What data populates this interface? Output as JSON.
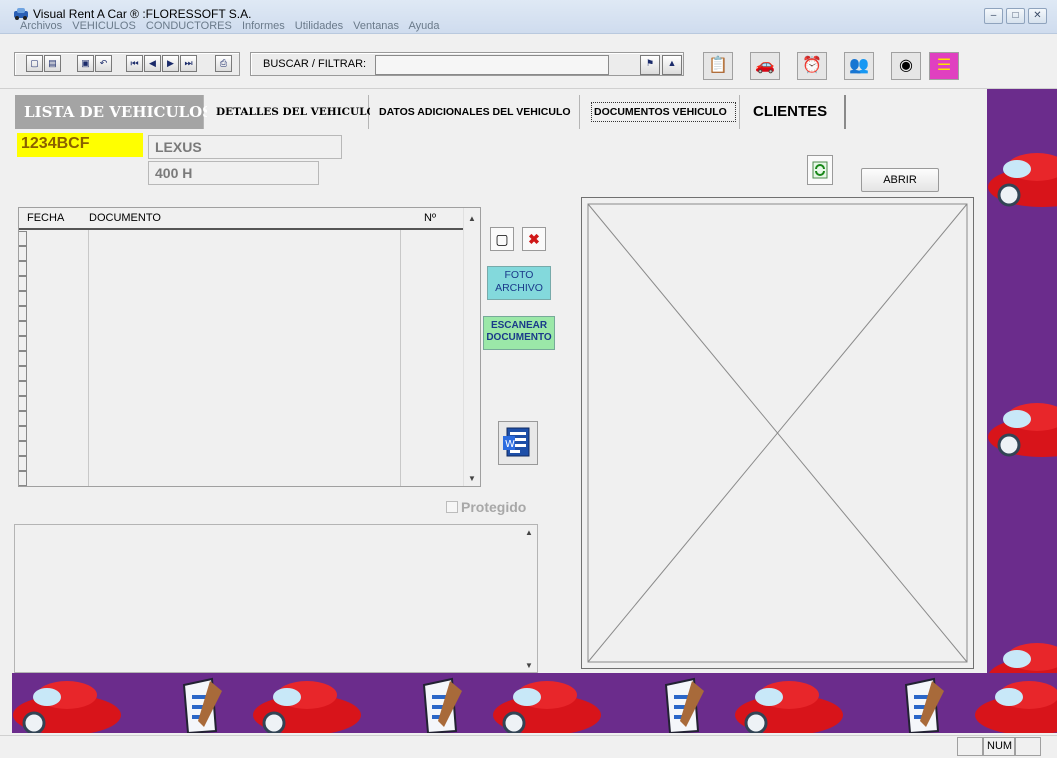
{
  "window": {
    "title": "Visual Rent A Car ® :FLORESSOFT S.A.",
    "controls": [
      "–",
      "□",
      "✕"
    ]
  },
  "menu": [
    "Archivos",
    "VEHICULOS",
    "CONDUCTORES",
    "Informes",
    "Utilidades",
    "Ventanas",
    "Ayuda"
  ],
  "toolbar": {
    "search_label": "BUSCAR / FILTRAR:",
    "search_value": ""
  },
  "tabs": [
    {
      "label": "LISTA DE VEHICULOS"
    },
    {
      "label": "DETALLES DEL VEHICULO"
    },
    {
      "label": "DATOS ADICIONALES DEL VEHICULO"
    },
    {
      "label": "DOCUMENTOS VEHICULO"
    },
    {
      "label": "CLIENTES"
    }
  ],
  "vehicle": {
    "plate": "1234BCF",
    "brand": "LEXUS",
    "model": "400 H"
  },
  "grid": {
    "columns": [
      "FECHA",
      "DOCUMENTO",
      "Nº"
    ],
    "rows": []
  },
  "buttons": {
    "foto_archivo": [
      "FOTO",
      "ARCHIVO"
    ],
    "escanear_documento": [
      "ESCANEAR",
      "DOCUMENTO"
    ],
    "abrir": "ABRIR"
  },
  "protegido": {
    "label": "Protegido",
    "checked": false
  },
  "memo": {
    "value": ""
  },
  "statusbar": {
    "num": "NUM"
  },
  "colors": {
    "purple_panel": "#6b2c8c",
    "plate_bg": "#ffff00",
    "foto_btn": "#83d9dc",
    "escanear_btn": "#9be8a8",
    "active_tab": "#a4a4a4"
  },
  "icons": {
    "toolbar": [
      "new-icon",
      "preview-icon",
      "save-icon",
      "undo-icon",
      "first-record-icon",
      "prev-record-icon",
      "next-record-icon",
      "last-record-icon",
      "print-icon",
      "filter-icon",
      "clear-filter-icon"
    ],
    "big_toolbar": [
      "calendar-list-icon",
      "car-icon",
      "clock-icon",
      "people-icon",
      "chart-icon",
      "flag-icon"
    ]
  }
}
